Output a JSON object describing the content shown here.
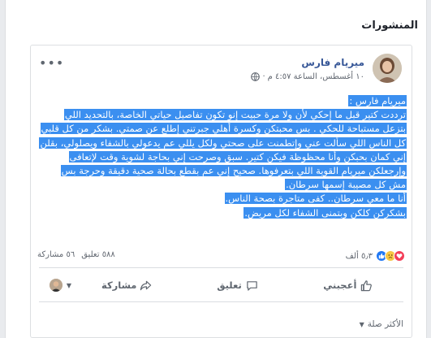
{
  "section": {
    "title": "المنشورات"
  },
  "post": {
    "author": "ميريام فارس",
    "timestamp": "١٠ أغسطس، الساعة ٤:٥٧ م",
    "meta_sep": "·",
    "privacy_icon": "globe-icon",
    "more_icon": "ellipsis-icon",
    "text_lines": [
      "ميريام فارس :",
      "ترددت كتير قبل ما إحكي لأن ولا مرة حبيت إنو تكون تفاصيل حياتي الخاصة، بالتحديد اللي",
      "بتزعل مستباحة للحكي . بس محبتكن وكسرة أهلي جبرتني إطلع عن صمتي. بشكر من كل قلبي",
      "كل الناس اللي سألت عني وإتطمنت على صحتي ولكل يللي عم يدعولي بالشفاء ويصلولي، بقلن",
      "إني كمان بحبكن وأنا محظوظة فيكن كتير. سبق وصرحت إني بحاجة لشوية وقت لإتعافى",
      "وإرجعلكن ميريام القوية اللي بتعرفوها. صحيح إني عم بقطع بحالة صحية دقيقة وحرجة بس",
      "مش كل مصيبة إسمها سرطان.",
      "أنا ما معي سرطان.. كفى متاجرة بصحة الناس.",
      "بشكركن كلكن وبتمنى الشفاء لكل مريض."
    ]
  },
  "stats": {
    "reactions_count": "٥٫٣ ألف",
    "reaction_icons": [
      "like-icon",
      "sad-icon",
      "heart-icon"
    ],
    "comments": "٥٨٨ تعليق",
    "shares": "٥٦ مشاركة"
  },
  "actions": {
    "like": "أعجبني",
    "comment": "تعليق",
    "share": "مشاركة"
  },
  "sort": {
    "label": "الأكثر صلة"
  },
  "colors": {
    "accent": "#385898",
    "highlight": "#3b8ff0",
    "like_blue": "#2078f4"
  }
}
